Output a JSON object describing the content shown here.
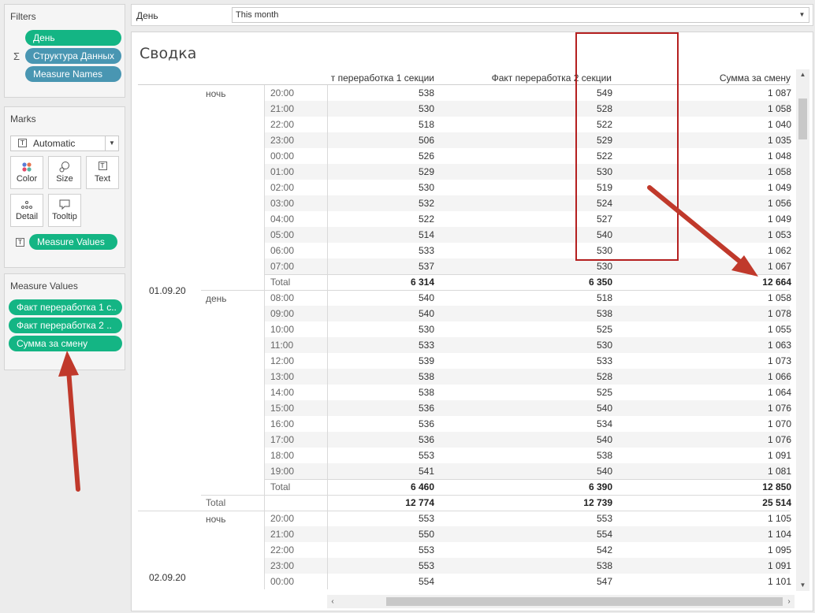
{
  "filters": {
    "title": "Filters",
    "pills": [
      {
        "label": "День",
        "color": "#14b584"
      },
      {
        "label": "Структура Данных",
        "color": "#4996b2",
        "sigma": "Σ"
      },
      {
        "label": "Measure Names",
        "color": "#4996b2"
      }
    ]
  },
  "marks": {
    "title": "Marks",
    "type": "Automatic",
    "buttons": [
      {
        "label": "Color",
        "icon": "color-icon"
      },
      {
        "label": "Size",
        "icon": "size-icon"
      },
      {
        "label": "Text",
        "icon": "text-icon"
      },
      {
        "label": "Detail",
        "icon": "detail-icon"
      },
      {
        "label": "Tooltip",
        "icon": "tooltip-icon"
      }
    ],
    "measure_pill": "Measure Values"
  },
  "measure_values": {
    "title": "Measure Values",
    "pills": [
      "Факт переработка 1 с..",
      "Факт переработка 2 ..",
      "Сумма за смену"
    ]
  },
  "filter_bar": {
    "label": "День",
    "selected": "This month"
  },
  "view": {
    "title": "Сводка",
    "headers": [
      "т переработка 1 секции",
      "Факт переработка 2 секции",
      "Сумма за смену"
    ],
    "total_label": "Total",
    "dates": [
      {
        "date": "01.09.20",
        "shifts": [
          {
            "name": "ночь",
            "rows": [
              {
                "time": "20:00",
                "v1": "538",
                "v2": "549",
                "v3": "1 087"
              },
              {
                "time": "21:00",
                "v1": "530",
                "v2": "528",
                "v3": "1 058"
              },
              {
                "time": "22:00",
                "v1": "518",
                "v2": "522",
                "v3": "1 040"
              },
              {
                "time": "23:00",
                "v1": "506",
                "v2": "529",
                "v3": "1 035"
              },
              {
                "time": "00:00",
                "v1": "526",
                "v2": "522",
                "v3": "1 048"
              },
              {
                "time": "01:00",
                "v1": "529",
                "v2": "530",
                "v3": "1 058"
              },
              {
                "time": "02:00",
                "v1": "530",
                "v2": "519",
                "v3": "1 049"
              },
              {
                "time": "03:00",
                "v1": "532",
                "v2": "524",
                "v3": "1 056"
              },
              {
                "time": "04:00",
                "v1": "522",
                "v2": "527",
                "v3": "1 049"
              },
              {
                "time": "05:00",
                "v1": "514",
                "v2": "540",
                "v3": "1 053"
              },
              {
                "time": "06:00",
                "v1": "533",
                "v2": "530",
                "v3": "1 062"
              },
              {
                "time": "07:00",
                "v1": "537",
                "v2": "530",
                "v3": "1 067"
              }
            ],
            "total": {
              "v1": "6 314",
              "v2": "6 350",
              "v3": "12 664"
            }
          },
          {
            "name": "день",
            "rows": [
              {
                "time": "08:00",
                "v1": "540",
                "v2": "518",
                "v3": "1 058"
              },
              {
                "time": "09:00",
                "v1": "540",
                "v2": "538",
                "v3": "1 078"
              },
              {
                "time": "10:00",
                "v1": "530",
                "v2": "525",
                "v3": "1 055"
              },
              {
                "time": "11:00",
                "v1": "533",
                "v2": "530",
                "v3": "1 063"
              },
              {
                "time": "12:00",
                "v1": "539",
                "v2": "533",
                "v3": "1 073"
              },
              {
                "time": "13:00",
                "v1": "538",
                "v2": "528",
                "v3": "1 066"
              },
              {
                "time": "14:00",
                "v1": "538",
                "v2": "525",
                "v3": "1 064"
              },
              {
                "time": "15:00",
                "v1": "536",
                "v2": "540",
                "v3": "1 076"
              },
              {
                "time": "16:00",
                "v1": "536",
                "v2": "534",
                "v3": "1 070"
              },
              {
                "time": "17:00",
                "v1": "536",
                "v2": "540",
                "v3": "1 076"
              },
              {
                "time": "18:00",
                "v1": "553",
                "v2": "538",
                "v3": "1 091"
              },
              {
                "time": "19:00",
                "v1": "541",
                "v2": "540",
                "v3": "1 081"
              }
            ],
            "total": {
              "v1": "6 460",
              "v2": "6 390",
              "v3": "12 850"
            }
          }
        ],
        "total": {
          "v1": "12 774",
          "v2": "12 739",
          "v3": "25 514"
        }
      },
      {
        "date": "02.09.20",
        "shifts": [
          {
            "name": "ночь",
            "rows": [
              {
                "time": "20:00",
                "v1": "553",
                "v2": "553",
                "v3": "1 105"
              },
              {
                "time": "21:00",
                "v1": "550",
                "v2": "554",
                "v3": "1 104"
              },
              {
                "time": "22:00",
                "v1": "553",
                "v2": "542",
                "v3": "1 095"
              },
              {
                "time": "23:00",
                "v1": "553",
                "v2": "538",
                "v3": "1 091"
              },
              {
                "time": "00:00",
                "v1": "554",
                "v2": "547",
                "v3": "1 101"
              }
            ]
          }
        ]
      }
    ]
  },
  "colors": {
    "green_pill": "#14b584",
    "blue_pill": "#4996b2",
    "annotation": "#c0392b",
    "highlight": "#b52020"
  }
}
